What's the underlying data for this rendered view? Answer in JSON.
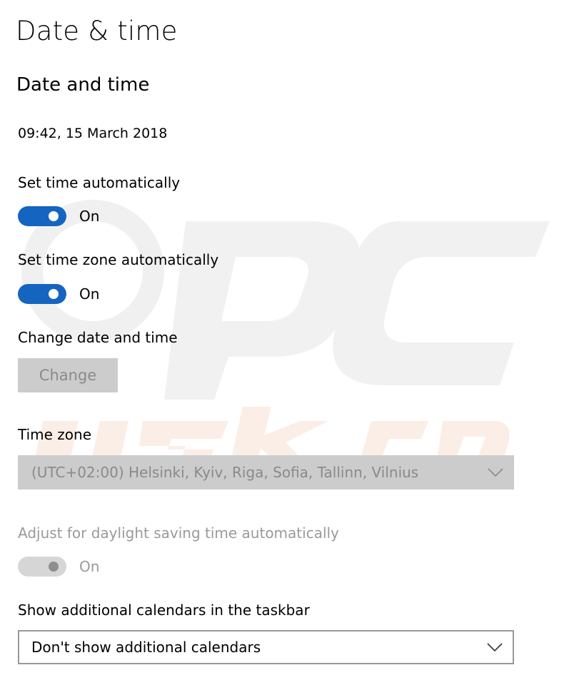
{
  "page": {
    "title": "Date & time",
    "section_title": "Date and time",
    "current_datetime": "09:42, 15 March 2018"
  },
  "set_time_auto": {
    "label": "Set time automatically",
    "state": "On",
    "enabled": true
  },
  "set_timezone_auto": {
    "label": "Set time zone automatically",
    "state": "On",
    "enabled": true
  },
  "change_datetime": {
    "label": "Change date and time",
    "button_label": "Change"
  },
  "time_zone": {
    "label": "Time zone",
    "selected": "(UTC+02:00) Helsinki, Kyiv, Riga, Sofia, Tallinn, Vilnius"
  },
  "daylight_saving": {
    "label": "Adjust for daylight saving time automatically",
    "state": "On",
    "enabled": false
  },
  "additional_calendars": {
    "label": "Show additional calendars in the taskbar",
    "selected": "Don't show additional calendars"
  },
  "icons": {
    "dropdown": "chevron-down-icon"
  },
  "colors": {
    "accent": "#1565c0",
    "disabled_fill": "#cccccc",
    "disabled_text": "#8a8a8a"
  }
}
